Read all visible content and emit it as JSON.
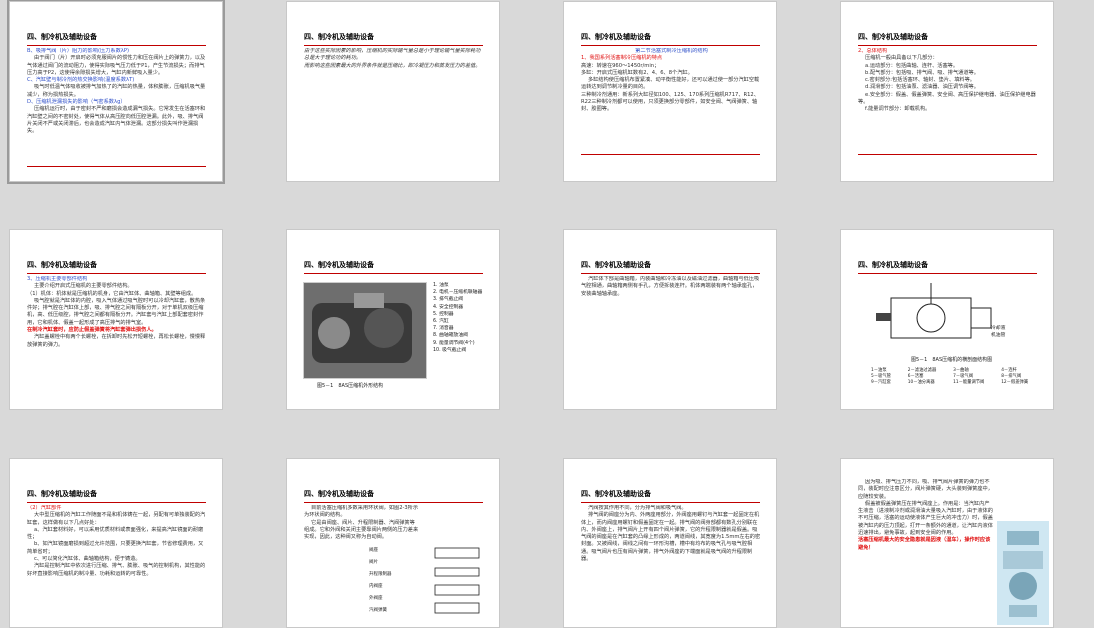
{
  "slides": [
    {
      "header": "四、制冷机及辅助设备",
      "lines": [
        {
          "t": "B、吸排气阀（片）阻力的影响(压力系数λP)",
          "c": "blue"
        },
        {
          "t": "由于阀门（片）开启时必须克服阀片的惯性力和压在阀片上的弹簧力，以及气体通过阀门的流动阻力，使得实际吸气压力低于P1，产生节流损失；而排气压力高于P2，这使得余隙损失增大，气缸内新鲜吸入量少。",
          "c": ""
        },
        {
          "t": "C、汽缸壁与制冷剂的热交换影响(温度系数λT)",
          "c": "blue"
        },
        {
          "t": "吸气时低温气体吸收被排气加热了的汽缸的热量，体积膨胀，压缩机吸气量减少，称为损热损失。",
          "c": ""
        },
        {
          "t": "D、压缩机泄漏损失的影响（气密系数λg）",
          "c": "blue"
        },
        {
          "t": "压缩机运行时，由于密封不严和磨损会造成漏气损失。它常发生在活塞环和汽缸壁之间的不密封处，使得气体从高压腔向低压腔泄漏。此外，吸、排气阀片关闭不严或关闭滞后，也会造成汽缸内气体泄漏。这部分损失叫作泄漏损失。",
          "c": ""
        }
      ]
    },
    {
      "header": "四、制冷机及辅助设备",
      "lines": [
        {
          "t": "由于这些实际因素的影响，压缩机的实际输气量总是小于理论输气量实际耗功总是大于理论功的耗功。",
          "c": "italic"
        },
        {
          "t": "而影响这些因素最大的外界条件就是压缩比，即冷凝压力和蒸发压力的差值。",
          "c": "italic"
        }
      ]
    },
    {
      "header": "四、制冷机及辅助设备",
      "lines": [
        {
          "t": "第二节活塞式制冷压缩机的结构",
          "c": "blue center"
        },
        {
          "t": "1、我国系列活塞制冷压缩机的特点",
          "c": "red"
        },
        {
          "t": "高速：转速在960～1450r/min；",
          "c": "redlead"
        },
        {
          "t": "多缸：开启式压缩机缸数有2、4、6、8个汽缸。",
          "c": "redlead"
        },
        {
          "t": "多缸结构使压缩机布置紧凑、动平衡性能好，还可以通过使一部分汽缸空载运转达到调节制冷量的目的。",
          "c": ""
        },
        {
          "t": "三种制冷剂通用：新系列大缸径如100、125、170系列压缩机R717、R12、R22三种制冷剂都可以使用，只须更换部分零部件，如安全阀、气阀弹簧、轴封、胶圈等。",
          "c": "redlead"
        }
      ]
    },
    {
      "header": "四、制冷机及辅助设备",
      "lines": [
        {
          "t": "2、总体结构",
          "c": "red"
        },
        {
          "t": "压缩机一般由具备以下几部分：",
          "c": ""
        },
        {
          "t": "a.运动部分：包括曲轴、连杆、活塞等。",
          "c": ""
        },
        {
          "t": "b.配气部分：包括吸、排气阀、吸、排气通道等。",
          "c": ""
        },
        {
          "t": "c.密封部分:包括活塞环、轴封、垫片、填料等。",
          "c": ""
        },
        {
          "t": "d.润滑部分：包括油泵、滤油器、油压调节阀等。",
          "c": ""
        },
        {
          "t": "e.安全部分：假盖、假盖弹簧、安全阀、高压保护继电器、油压保护继电器等。",
          "c": ""
        },
        {
          "t": "f.能量调节部分：卸载机构。",
          "c": ""
        }
      ]
    },
    {
      "header": "四、制冷机及辅助设备",
      "lines": [
        {
          "t": "3、压缩机主要零部件结构",
          "c": "blue"
        },
        {
          "t": "主要介绍开启式压缩机的主要零部件结构。",
          "c": ""
        },
        {
          "t": "（1）机体：机体就是压缩机的机身，它由汽缸体、曲轴箱、其壁等组成。",
          "c": "redlead"
        },
        {
          "t": "吸气腔就是汽缸体的内腔，吸入气体通过吸气腔时可以冷却汽缸套，散热条件好；排气腔在汽缸体上部，吸、排气腔之间有隔板分开，对于单机双级压缩机，高、低压级腔，排气腔之间都有隔板分开。汽缸套与汽缸上部配套密封作用，它和机体、假盖一起形成了高压排气的排气室。",
          "c": ""
        },
        {
          "t": "在制冷汽缸套时，应防止假盖弹簧将汽缸套弹出损伤人。",
          "c": "redb"
        },
        {
          "t": "汽缸盖螺栓中有两个长螺栓，在拆卸时先松开短螺栓，再松长螺栓，慢慢释放弹簧的弹力。",
          "c": ""
        }
      ]
    },
    {
      "header": "四、制冷机及辅助设备",
      "caption": "图5－1　8AS压缩机外形结构",
      "legend": [
        "1. 油泵",
        "2. 电机－压缩机联轴器",
        "3. 排气截止阀",
        "4. 安全控制器",
        "5. 控制器",
        "6. 汽缸",
        "7. 消音器",
        "8. 曲轴箱放油阀",
        "9. 能量调节阀(4个)",
        "10. 吸气截止阀"
      ]
    },
    {
      "header": "四、制冷机及辅助设备",
      "lines": [
        {
          "t": "汽缸体下部是曲轴箱，内装曲轴和冷冻油以及磁油过滤器，曲轴箱与低压吸气腔相通，曲轴箱两侧有手孔，方便拆装连杆。机体两端装有两个轴承座孔，安装曲轴轴承座。",
          "c": ""
        }
      ]
    },
    {
      "header": "四、制冷机及辅助设备",
      "caption": "图5－1　8AS压缩机的横剖面结构图",
      "legend": [
        "1－油泵",
        "2－滤油过滤器",
        "3－曲轴",
        "4－连杆",
        "5－吸气管",
        "6－活塞",
        "7－吸气阀",
        "8－排气阀",
        "9－汽缸套",
        "10－油分离器",
        "11－能量调节阀",
        "12－假盖弹簧"
      ],
      "tags": [
        "冷却液",
        "机油管"
      ]
    },
    {
      "header": "四、制冷机及辅助设备",
      "lines": [
        {
          "t": "（2）汽缸部件",
          "c": "red"
        },
        {
          "t": "大中型压缩机的汽缸工作随面不是和机体铸在一起，另配有可单独装配的汽缸套，这样做有以下几点好处：",
          "c": ""
        },
        {
          "t": "a、汽缸套材料好，可以采用优质材料或表面强化，来提高汽缸镜面的耐磨性；",
          "c": ""
        },
        {
          "t": "b、如汽缸镜面磨损到超过允许范围，只要更换汽缸套，节省修理费用，又简单省时；",
          "c": ""
        },
        {
          "t": "c、可以简化汽缸体、曲轴箱结构，便于铸造。",
          "c": ""
        },
        {
          "t": "汽缸是控制汽缸中依次进行压缩、排气、膨胀、吸气的控制机构，其性能的好坏直接影响压缩机的制冷量、功耗和运转的可靠性。",
          "c": ""
        }
      ]
    },
    {
      "header": "四、制冷机及辅助设备",
      "lines": [
        {
          "t": "目前活塞压缩机多数采用环状阀，如图2-3所示为环状阀的结构。",
          "c": ""
        },
        {
          "t": "它是由阀座、阀片、升程限制器、汽阀弹簧等组成。它和外阀和关闭主要靠阀片两侧的压力差来实现，因此，这种阀又称为自动阀。",
          "c": ""
        }
      ],
      "parts": [
        "阀座",
        "阀片",
        "升程限制器",
        "内阀座",
        "外阀座",
        "汽阀弹簧"
      ]
    },
    {
      "header": "四、制冷机及辅助设备",
      "lines": [
        {
          "t": "汽阀按其作用不同，分为排气阀和吸气阀。",
          "c": ""
        },
        {
          "t": "排气阀的阀座分为内、外两座用部分，外阀座用螺钉与汽缸套一起固定在机体上，而内阀座用螺钉和假盖固定在一起。排气阀的阀身部都有数孔分别联在内、外阀座上，排气阀片上开有四个阀片弹簧，它的升程限制器就是假盖。吸气阀的阀座是在汽缸套的凸缘上形成的，两道阀线，其宽度为1.5mm左右的密封面。又被阀线，阀线之间有一环形沟槽，槽中有均布的吸气孔与吸气腔相通。吸气阀片也压有阀片弹簧，排气外阀座的下端面就是吸气阀的升程限制器。",
          "c": ""
        }
      ]
    },
    {
      "header": "",
      "lines": [
        {
          "t": "因为吸、排气压力不同，吸、排气阀片弹簧的弹力也不同，装配时应注意区分，阀片弹簧硬，大头装到弹簧座中，应随较安装。",
          "c": ""
        },
        {
          "t": "假盖被假盖弹簧压在排气阀座上。作用是：当汽缸内产生液击（进液制冷剂或润滑油大量吸入汽缸时，由于液体的不可压缩，活塞的运动使液体产生巨大的冲击力）时，假盖被汽缸内的压力顶起，打开一条额外的通道，让汽缸内液体迅速排出，避免事故，起到安全阀的作用。",
          "c": ""
        },
        {
          "t": "活塞压缩机最大的安全隐患就是因液（湿车），操作时应该避免！",
          "c": "redb"
        }
      ]
    }
  ]
}
